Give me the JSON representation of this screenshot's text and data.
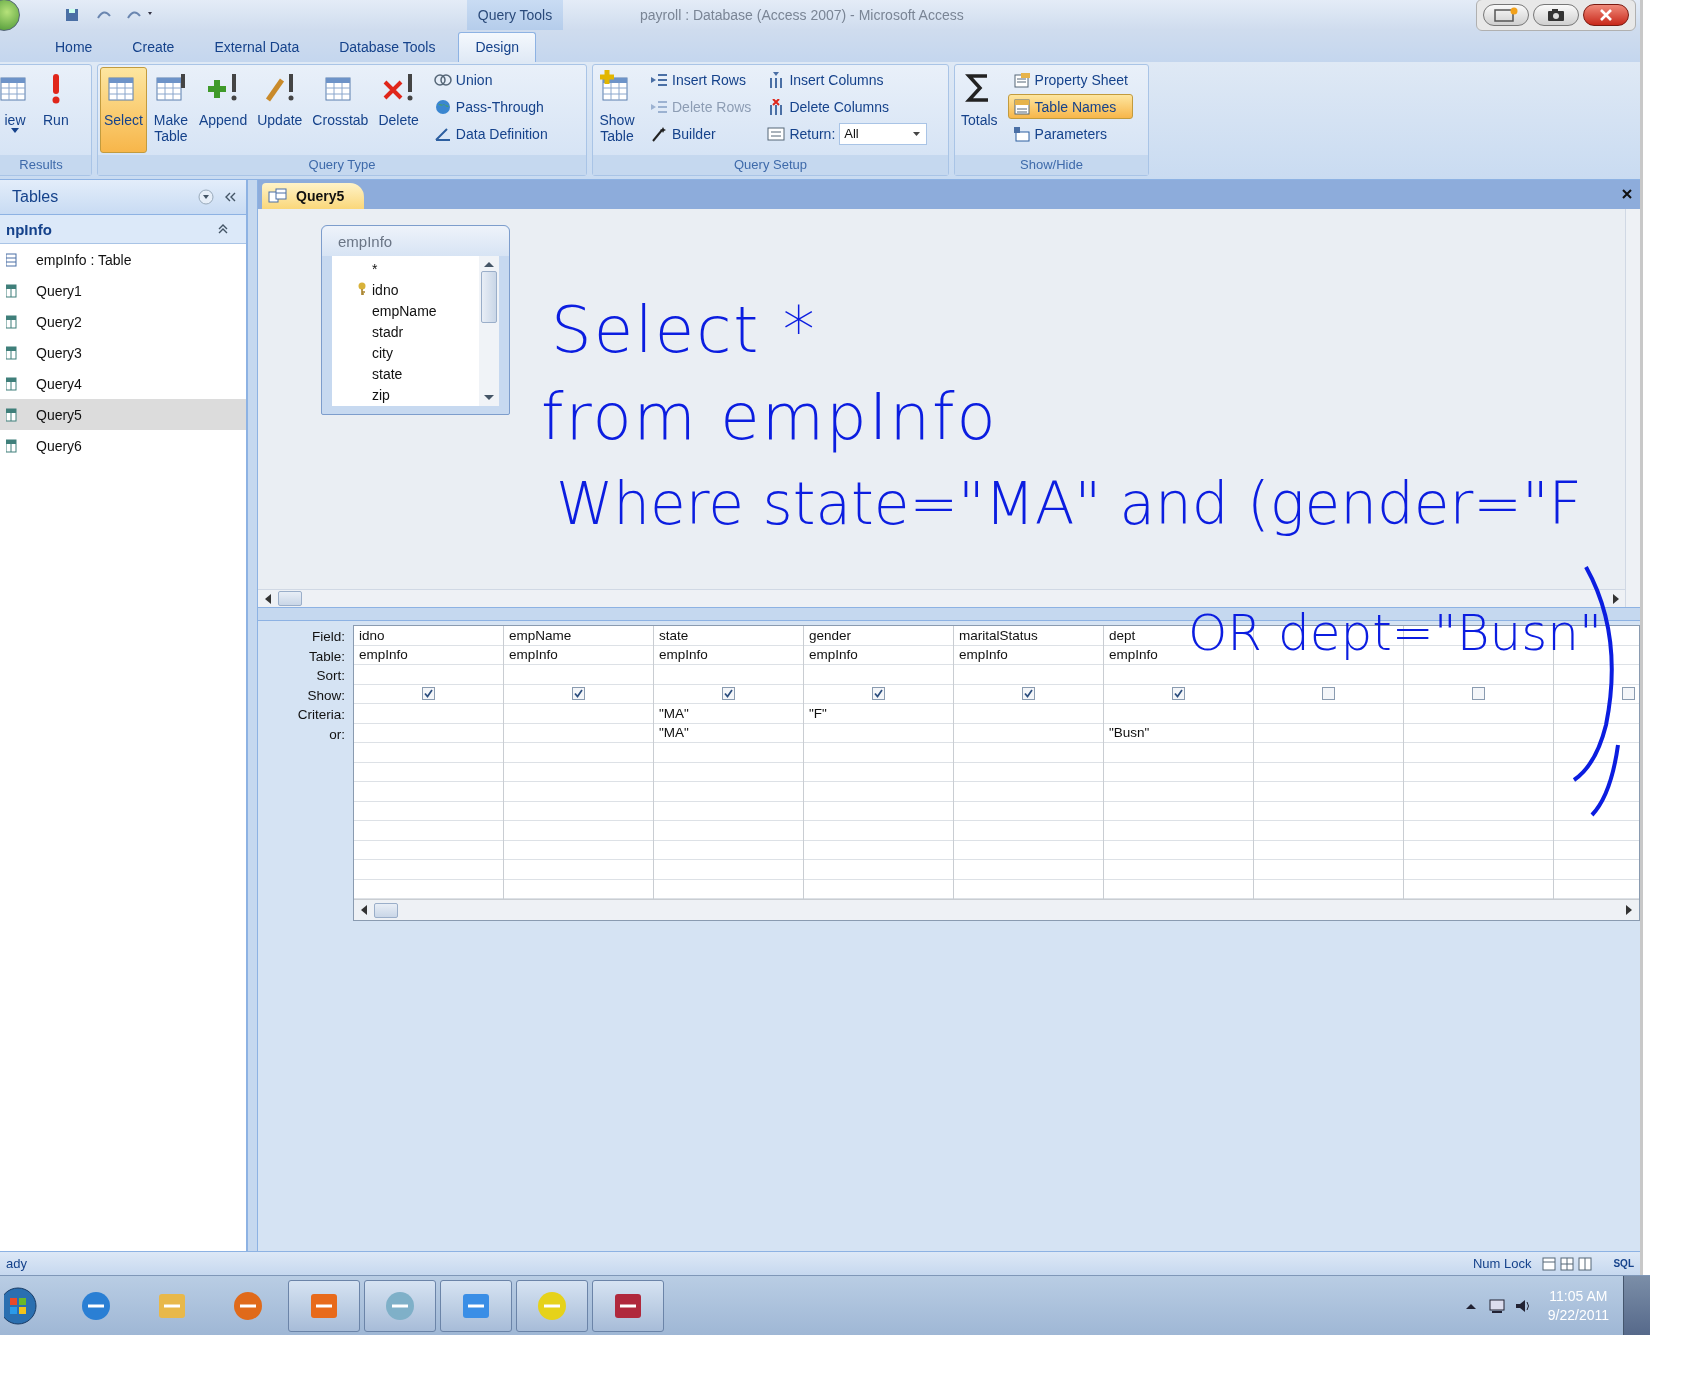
{
  "title_bar": {
    "context_label": "Query Tools",
    "title": "payroll : Database (Access 2007) - Microsoft Access"
  },
  "ribbon_tabs": [
    {
      "label": "Home",
      "selected": false
    },
    {
      "label": "Create",
      "selected": false
    },
    {
      "label": "External Data",
      "selected": false
    },
    {
      "label": "Database Tools",
      "selected": false
    },
    {
      "label": "Design",
      "selected": true
    }
  ],
  "ribbon": {
    "groups": [
      {
        "label": "Results",
        "large": [
          {
            "label": "iew",
            "dropdown": true,
            "selected": false
          },
          {
            "label": "Run",
            "dropdown": false,
            "selected": false
          }
        ]
      },
      {
        "label": "Query Type",
        "large": [
          {
            "label": "Select",
            "dropdown": false,
            "selected": true
          },
          {
            "label": "Make\nTable",
            "dropdown": false,
            "selected": false
          },
          {
            "label": "Append",
            "dropdown": false,
            "selected": false
          },
          {
            "label": "Update",
            "dropdown": false,
            "selected": false
          },
          {
            "label": "Crosstab",
            "dropdown": false,
            "selected": false
          },
          {
            "label": "Delete",
            "dropdown": false,
            "selected": false
          }
        ],
        "small": [
          {
            "label": "Union",
            "selected": false,
            "disabled": false
          },
          {
            "label": "Pass-Through",
            "selected": false,
            "disabled": false
          },
          {
            "label": "Data Definition",
            "selected": false,
            "disabled": false
          }
        ]
      },
      {
        "label": "Query Setup",
        "large": [
          {
            "label": "Show\nTable",
            "dropdown": false,
            "selected": false
          }
        ],
        "small": [
          {
            "label": "Insert Rows",
            "selected": false,
            "disabled": false
          },
          {
            "label": "Delete Rows",
            "selected": false,
            "disabled": true
          },
          {
            "label": "Builder",
            "selected": false,
            "disabled": false
          }
        ],
        "small2": [
          {
            "label": "Insert Columns",
            "selected": false,
            "disabled": false
          },
          {
            "label": "Delete Columns",
            "selected": false,
            "disabled": false
          }
        ],
        "return": {
          "label": "Return:",
          "value": "All"
        }
      },
      {
        "label": "Show/Hide",
        "large": [
          {
            "label": "Totals",
            "dropdown": false,
            "selected": false
          }
        ],
        "small": [
          {
            "label": "Property Sheet",
            "selected": false,
            "disabled": false
          },
          {
            "label": "Table Names",
            "selected": true,
            "disabled": false
          },
          {
            "label": "Parameters",
            "selected": false,
            "disabled": false
          }
        ]
      }
    ]
  },
  "nav_pane": {
    "title": "Tables",
    "group": "npInfo",
    "items": [
      {
        "label": "empInfo : Table",
        "kind": "table",
        "selected": false
      },
      {
        "label": "Query1",
        "kind": "query",
        "selected": false
      },
      {
        "label": "Query2",
        "kind": "query",
        "selected": false
      },
      {
        "label": "Query3",
        "kind": "query",
        "selected": false
      },
      {
        "label": "Query4",
        "kind": "query",
        "selected": false
      },
      {
        "label": "Query5",
        "kind": "query",
        "selected": true
      },
      {
        "label": "Query6",
        "kind": "query",
        "selected": false
      }
    ]
  },
  "document_tab": {
    "label": "Query5"
  },
  "table_box": {
    "title": "empInfo",
    "fields": [
      {
        "name": "*",
        "key": false
      },
      {
        "name": "idno",
        "key": true
      },
      {
        "name": "empName",
        "key": false
      },
      {
        "name": "stadr",
        "key": false
      },
      {
        "name": "city",
        "key": false
      },
      {
        "name": "state",
        "key": false
      },
      {
        "name": "zip",
        "key": false
      }
    ]
  },
  "ink": {
    "lines": [
      "Select *",
      "from empInfo",
      "Where state=\"MA\" and (gender=\"F",
      "OR dept=\"Busn\""
    ]
  },
  "qbe_grid": {
    "row_labels": [
      "Field:",
      "Table:",
      "Sort:",
      "Show:",
      "Criteria:",
      "or:"
    ],
    "columns": [
      {
        "field": "idno",
        "table": "empInfo",
        "show": true
      },
      {
        "field": "empName",
        "table": "empInfo",
        "show": true
      },
      {
        "field": "state",
        "table": "empInfo",
        "show": true,
        "criteria": "\"MA\"",
        "or": "\"MA\""
      },
      {
        "field": "gender",
        "table": "empInfo",
        "show": true,
        "criteria": "\"F\""
      },
      {
        "field": "maritalStatus",
        "table": "empInfo",
        "show": true
      },
      {
        "field": "dept",
        "table": "empInfo",
        "show": true,
        "or": "\"Busn\""
      },
      {
        "show": false
      },
      {
        "show": false
      },
      {
        "show": false
      }
    ]
  },
  "status_bar": {
    "left": "ady",
    "num_lock": "Num Lock",
    "view_label": "SQL"
  },
  "taskbar": {
    "apps": [
      {
        "open": false
      },
      {
        "open": false
      },
      {
        "open": false
      },
      {
        "open": true
      },
      {
        "open": true
      },
      {
        "open": true
      },
      {
        "open": true
      },
      {
        "open": true
      }
    ],
    "time": "11:05 AM",
    "date": "9/22/2011"
  }
}
